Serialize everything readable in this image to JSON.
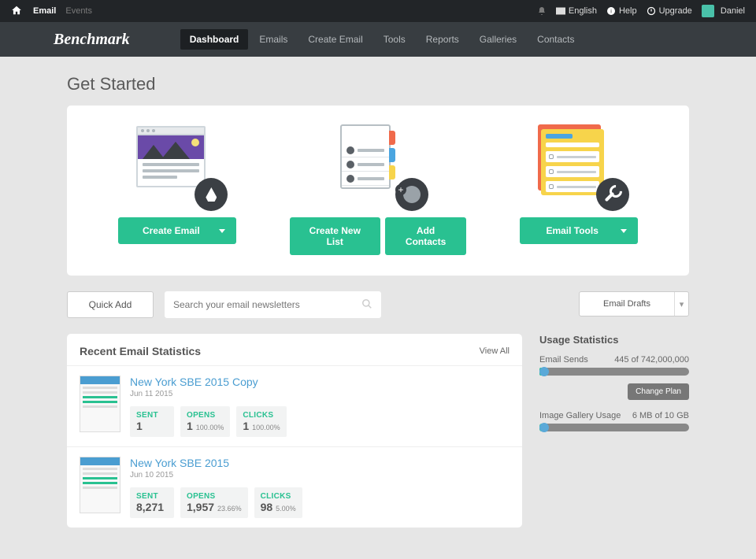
{
  "topbar": {
    "breadcrumb": [
      "Email",
      "Events"
    ],
    "lang": "English",
    "help": "Help",
    "upgrade": "Upgrade",
    "user": "Daniel"
  },
  "nav": {
    "brand": "Benchmark",
    "items": [
      "Dashboard",
      "Emails",
      "Create Email",
      "Tools",
      "Reports",
      "Galleries",
      "Contacts"
    ],
    "active": 0
  },
  "page_title": "Get Started",
  "getstarted": {
    "create_email": "Create Email",
    "create_list": "Create New List",
    "add_contacts": "Add Contacts",
    "email_tools": "Email Tools"
  },
  "quick_add": "Quick Add",
  "search_placeholder": "Search your email newsletters",
  "drafts": "Email Drafts",
  "recent": {
    "title": "Recent Email Statistics",
    "view_all": "View All",
    "labels": {
      "sent": "SENT",
      "opens": "OPENS",
      "clicks": "CLICKS"
    },
    "rows": [
      {
        "title": "New York SBE 2015 Copy",
        "date": "Jun 11 2015",
        "sent": "1",
        "opens": "1",
        "opens_pct": "100.00%",
        "clicks": "1",
        "clicks_pct": "100.00%"
      },
      {
        "title": "New York SBE 2015",
        "date": "Jun 10 2015",
        "sent": "8,271",
        "opens": "1,957",
        "opens_pct": "23.66%",
        "clicks": "98",
        "clicks_pct": "5.00%"
      }
    ]
  },
  "usage": {
    "title": "Usage Statistics",
    "sends_label": "Email Sends",
    "sends_value": "445 of 742,000,000",
    "change_plan": "Change Plan",
    "gallery_label": "Image Gallery Usage",
    "gallery_value": "6 MB of 10 GB"
  }
}
